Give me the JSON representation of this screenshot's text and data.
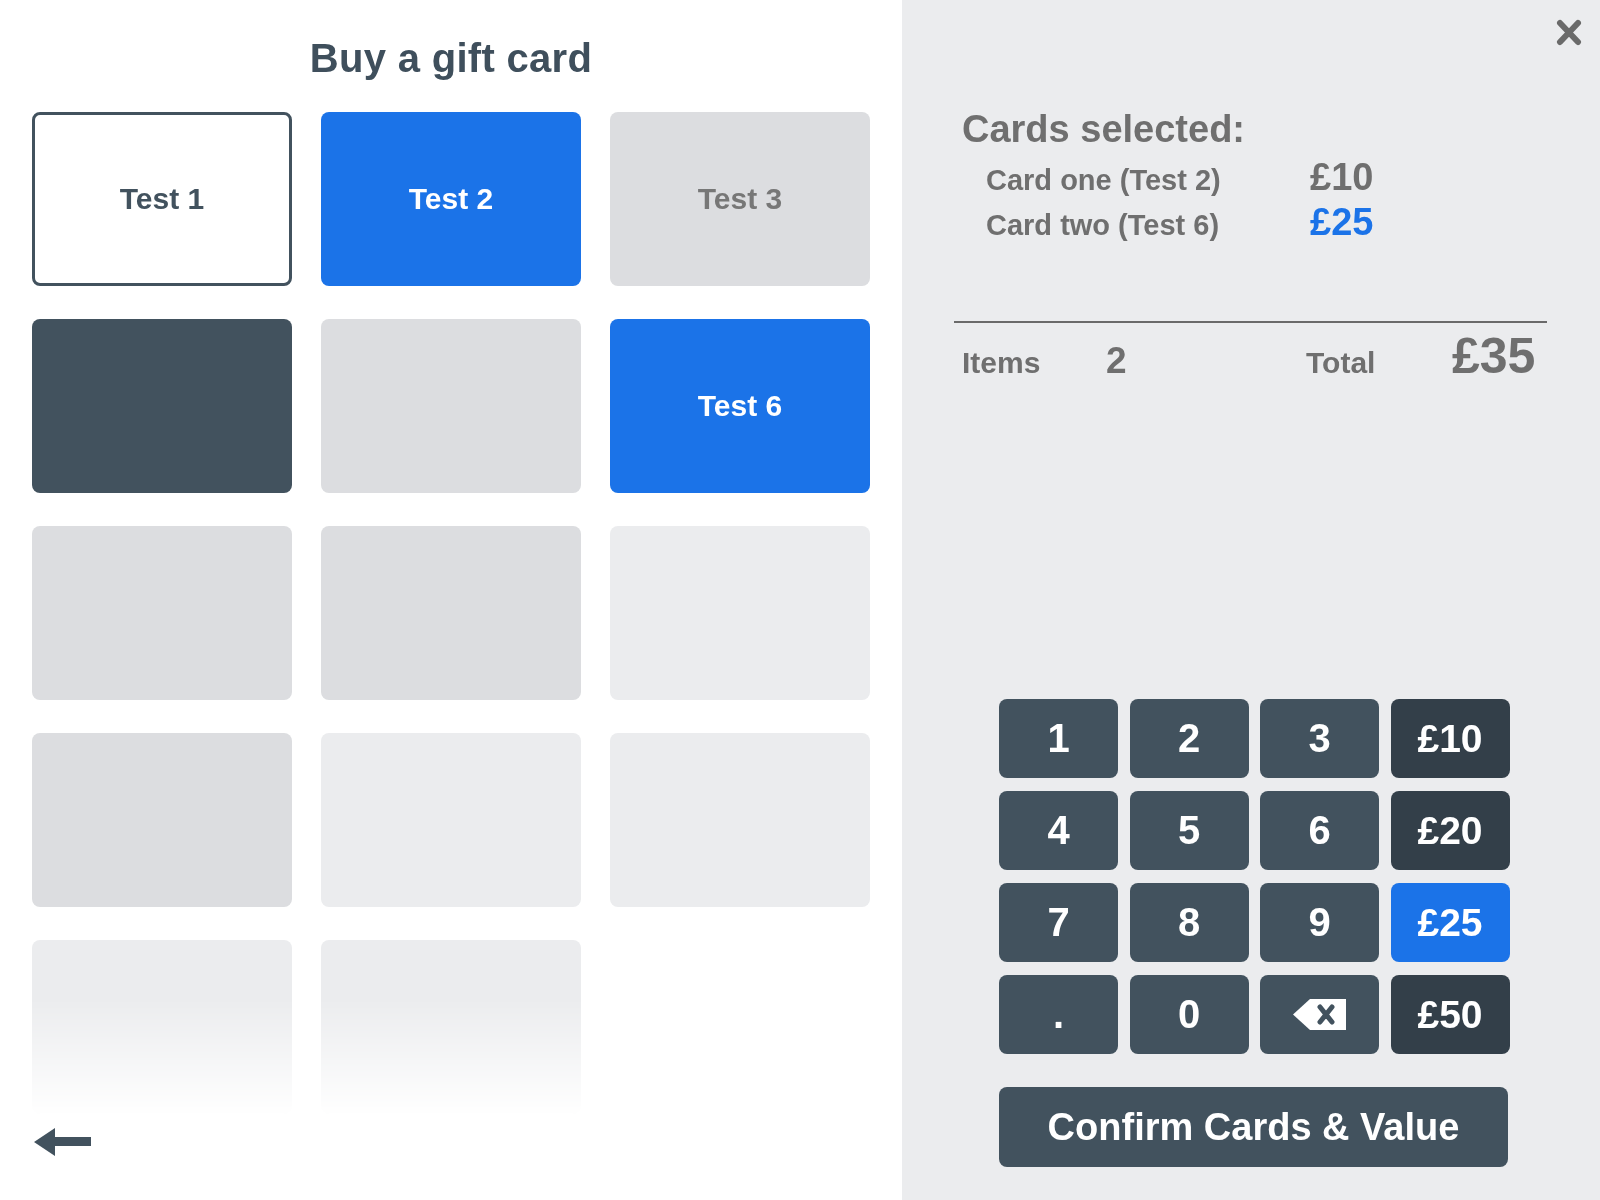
{
  "title": "Buy a gift card",
  "cards": [
    {
      "kind": "outlined",
      "label": "Test 1",
      "selected": false
    },
    {
      "label": "Test 2",
      "selected": true
    },
    {
      "kind": "gray",
      "label": "Test 3",
      "selected": false
    },
    {
      "kind": "dark",
      "selected": false
    },
    {
      "kind": "gray",
      "selected": false
    },
    {
      "label": "Test 6",
      "selected": true
    },
    {
      "kind": "gray",
      "selected": false
    },
    {
      "kind": "gray",
      "selected": false
    },
    {
      "kind": "light",
      "selected": false
    },
    {
      "kind": "gray",
      "selected": false
    },
    {
      "kind": "light",
      "selected": false
    },
    {
      "kind": "light",
      "selected": false
    },
    {
      "kind": "light",
      "selected": false
    },
    {
      "kind": "light",
      "selected": false
    }
  ],
  "summary": {
    "heading": "Cards selected:",
    "lines": [
      {
        "label": "Card one (Test 2)",
        "amount": "£10",
        "selected": false
      },
      {
        "label": "Card two (Test 6)",
        "amount": "£25",
        "selected": true
      }
    ],
    "items_label": "Items",
    "items_count": "2",
    "total_label": "Total",
    "total": "£35"
  },
  "keypad": {
    "digit_keys": [
      {
        "kind": "digit",
        "label": "1"
      },
      {
        "kind": "digit",
        "label": "2"
      },
      {
        "kind": "digit",
        "label": "3"
      },
      {
        "kind": "digit",
        "label": "4"
      },
      {
        "kind": "digit",
        "label": "5"
      },
      {
        "kind": "digit",
        "label": "6"
      },
      {
        "kind": "digit",
        "label": "7"
      },
      {
        "kind": "digit",
        "label": "8"
      },
      {
        "kind": "digit",
        "label": "9"
      },
      {
        "kind": "digit",
        "label": "."
      },
      {
        "kind": "digit",
        "label": "0"
      },
      {
        "kind": "backspace"
      }
    ],
    "amount_keys": [
      {
        "label": "£10",
        "selected": false
      },
      {
        "label": "£20",
        "selected": false
      },
      {
        "label": "£25",
        "selected": true
      },
      {
        "label": "£50",
        "selected": false
      }
    ]
  },
  "confirm_button": {
    "label": "Confirm Cards & Value"
  }
}
